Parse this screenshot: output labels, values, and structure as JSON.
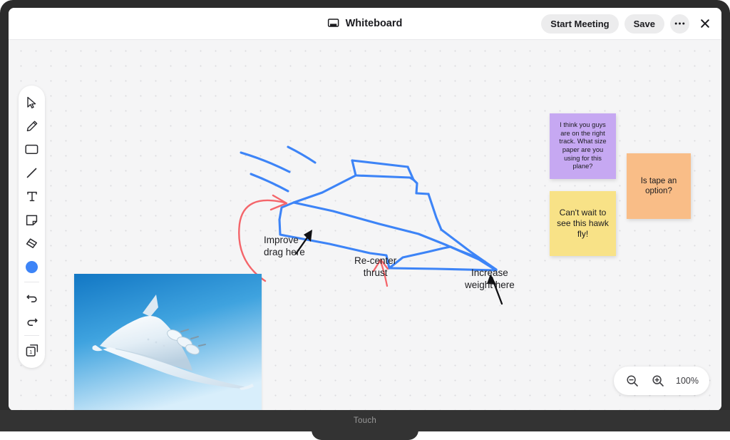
{
  "header": {
    "title": "Whiteboard",
    "title_icon": "whiteboard-screen-icon",
    "start_meeting_label": "Start Meeting",
    "save_label": "Save",
    "more_label": "•••",
    "close_icon": "close-icon"
  },
  "toolbar": {
    "items": [
      {
        "name": "select-tool",
        "icon": "cursor-arrow-icon"
      },
      {
        "name": "pen-tool",
        "icon": "pencil-icon"
      },
      {
        "name": "rectangle-tool",
        "icon": "rectangle-icon"
      },
      {
        "name": "line-tool",
        "icon": "line-icon"
      },
      {
        "name": "text-tool",
        "icon": "text-t-icon"
      },
      {
        "name": "sticky-note-tool",
        "icon": "sticky-note-icon"
      },
      {
        "name": "eraser-tool",
        "icon": "eraser-icon"
      },
      {
        "name": "color-picker",
        "icon": "color-circle-icon"
      },
      {
        "name": "undo",
        "icon": "undo-arrow-icon"
      },
      {
        "name": "redo",
        "icon": "redo-arrow-icon"
      },
      {
        "name": "pages",
        "icon": "pages-stack-icon"
      }
    ],
    "selected_color": "#3d84f7",
    "page_count": "1"
  },
  "notes": [
    {
      "id": "note-purple",
      "color": "#c6a8f2",
      "text": "I think you guys are on the right track. What size paper are you using for this plane?"
    },
    {
      "id": "note-yellow",
      "color": "#f8e287",
      "text": "Can't wait to see this hawk fly!"
    },
    {
      "id": "note-orange",
      "color": "#f9bd87",
      "text": "Is tape an option?"
    }
  ],
  "annotations": [
    {
      "id": "annot-drag",
      "text": "Improve\ndrag here",
      "arrow": "black"
    },
    {
      "id": "annot-thrust",
      "text": "Re-center\nthrust",
      "arrow": "red"
    },
    {
      "id": "annot-weight",
      "text": "Increase\nweight here",
      "arrow": "black"
    }
  ],
  "sketch": {
    "ink_color": "#3d84f7",
    "accent_color": "#f4656a",
    "description": "hand-drawn paper airplane / blended wing aircraft with speed lines"
  },
  "photo": {
    "alt": "blended wing body concept aircraft flying in blue sky"
  },
  "zoom": {
    "zoom_out_icon": "zoom-out-icon",
    "zoom_in_icon": "zoom-in-icon",
    "level": "100%"
  },
  "device": {
    "chin_label": "Touch"
  }
}
